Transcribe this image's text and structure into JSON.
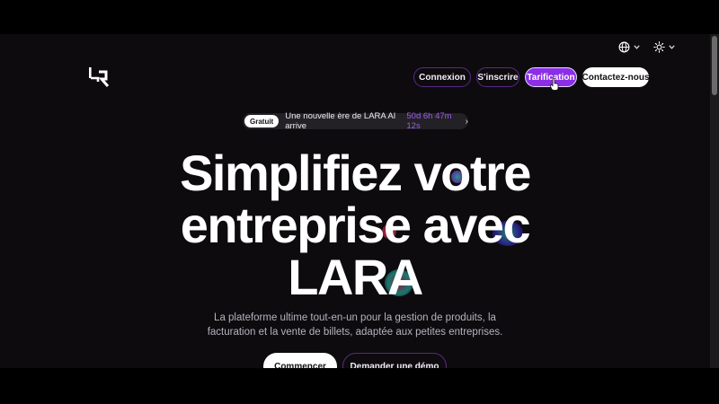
{
  "header": {
    "language_icon": "globe-icon",
    "theme_icon": "sun-icon",
    "nav": {
      "login": "Connexion",
      "signup": "S'inscrire",
      "pricing": "Tarification",
      "contact": "Contactez-nous"
    }
  },
  "announcement": {
    "badge": "Gratuit",
    "text": "Une nouvelle ère de LARA AI arrive",
    "countdown": "50d 6h 47m 12s",
    "arrow": "›"
  },
  "hero": {
    "line1": "Simplifiez votre",
    "line2": "entreprise avec",
    "line3": "LARA",
    "subtitle": "La plateforme ultime tout-en-un pour la gestion de produits, la facturation et la vente de billets, adaptée aux petites entreprises."
  },
  "cta": {
    "primary": "Commencer",
    "secondary": "Demander une démo"
  },
  "colors": {
    "accent": "#8b2ee6",
    "background": "#0d0b0e",
    "countdown": "#9d5cf0"
  }
}
